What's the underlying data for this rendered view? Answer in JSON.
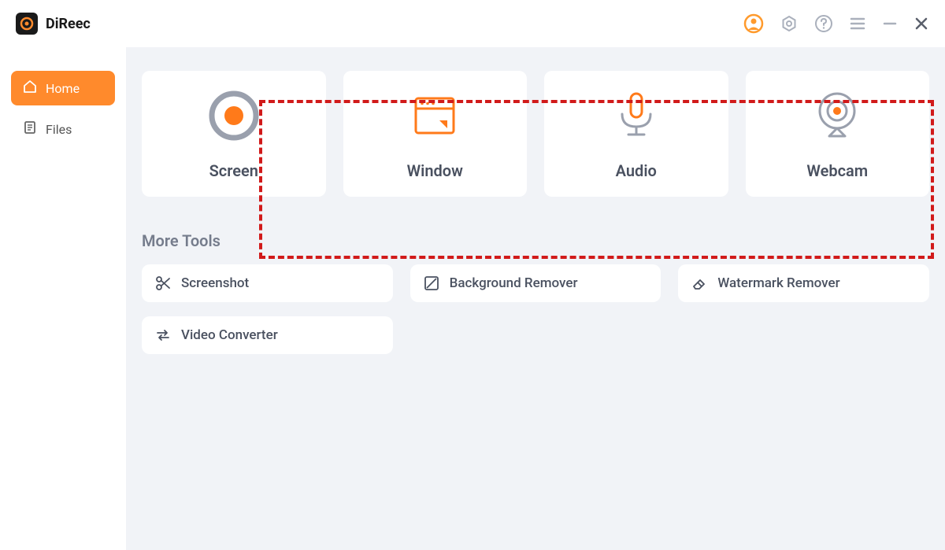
{
  "app": {
    "name": "DiReec"
  },
  "sidebar": {
    "items": [
      {
        "label": "Home"
      },
      {
        "label": "Files"
      }
    ]
  },
  "recorders": [
    {
      "label": "Screen"
    },
    {
      "label": "Window"
    },
    {
      "label": "Audio"
    },
    {
      "label": "Webcam"
    }
  ],
  "moreToolsTitle": "More Tools",
  "tools": [
    {
      "label": "Screenshot"
    },
    {
      "label": "Background Remover"
    },
    {
      "label": "Watermark Remover"
    },
    {
      "label": "Video Converter"
    }
  ]
}
